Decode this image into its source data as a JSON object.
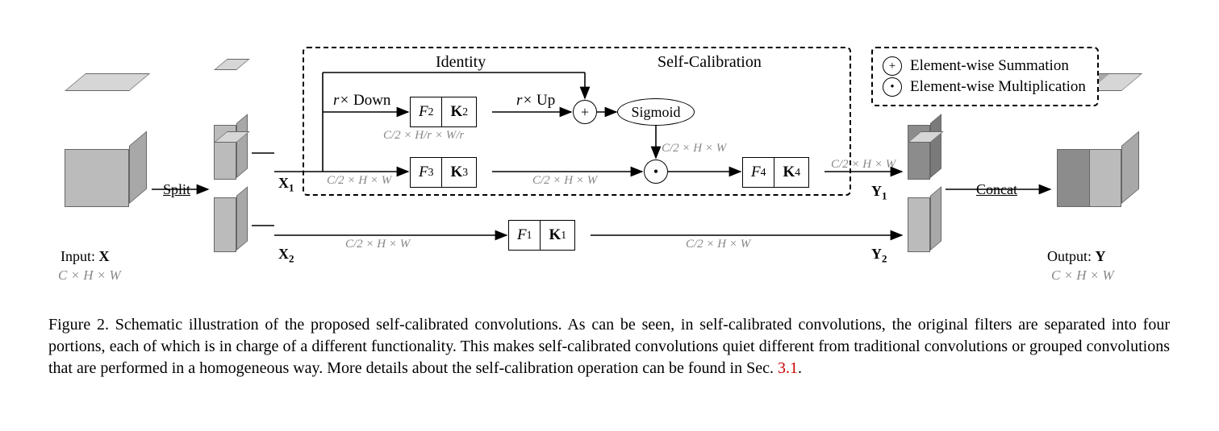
{
  "input": {
    "label_prefix": "Input: ",
    "label_var": "X",
    "dims": "C × H × W"
  },
  "output": {
    "label_prefix": "Output: ",
    "label_var": "Y",
    "dims": "C × H × W"
  },
  "split_label": "Split",
  "concat_label": "Concat",
  "x1_label": "X",
  "x1_sub": "1",
  "x2_label": "X",
  "x2_sub": "2",
  "y1_label": "Y",
  "y1_sub": "1",
  "y2_label": "Y",
  "y2_sub": "2",
  "self_calib_title": "Self-Calibration",
  "identity_label": "Identity",
  "down_label_prefix": "r× ",
  "down_label": "Down",
  "up_label_prefix": "r× ",
  "up_label": "Up",
  "sigmoid_label": "Sigmoid",
  "dims_half": "C/2 × H × W",
  "dims_down": "C/2 × H/r × W/r",
  "ops": {
    "f1": {
      "F": "F",
      "Fsub": "1",
      "K": "K",
      "Ksub": "1"
    },
    "f2": {
      "F": "F",
      "Fsub": "2",
      "K": "K",
      "Ksub": "2"
    },
    "f3": {
      "F": "F",
      "Fsub": "3",
      "K": "K",
      "Ksub": "3"
    },
    "f4": {
      "F": "F",
      "Fsub": "4",
      "K": "K",
      "Ksub": "4"
    }
  },
  "legend": {
    "sum": "Element-wise Summation",
    "mul": "Element-wise Multiplication"
  },
  "caption": {
    "prefix": "Figure 2. Schematic illustration of the proposed self-calibrated convolutions. As can be seen, in self-calibrated convolutions, the original filters are separated into four portions, each of which is in charge of a different functionality. This makes self-calibrated convolutions quiet different from traditional convolutions or grouped convolutions that are performed in a homogeneous way. More details about the self-calibration operation can be found in Sec. ",
    "secref": "3.1",
    "suffix": "."
  }
}
